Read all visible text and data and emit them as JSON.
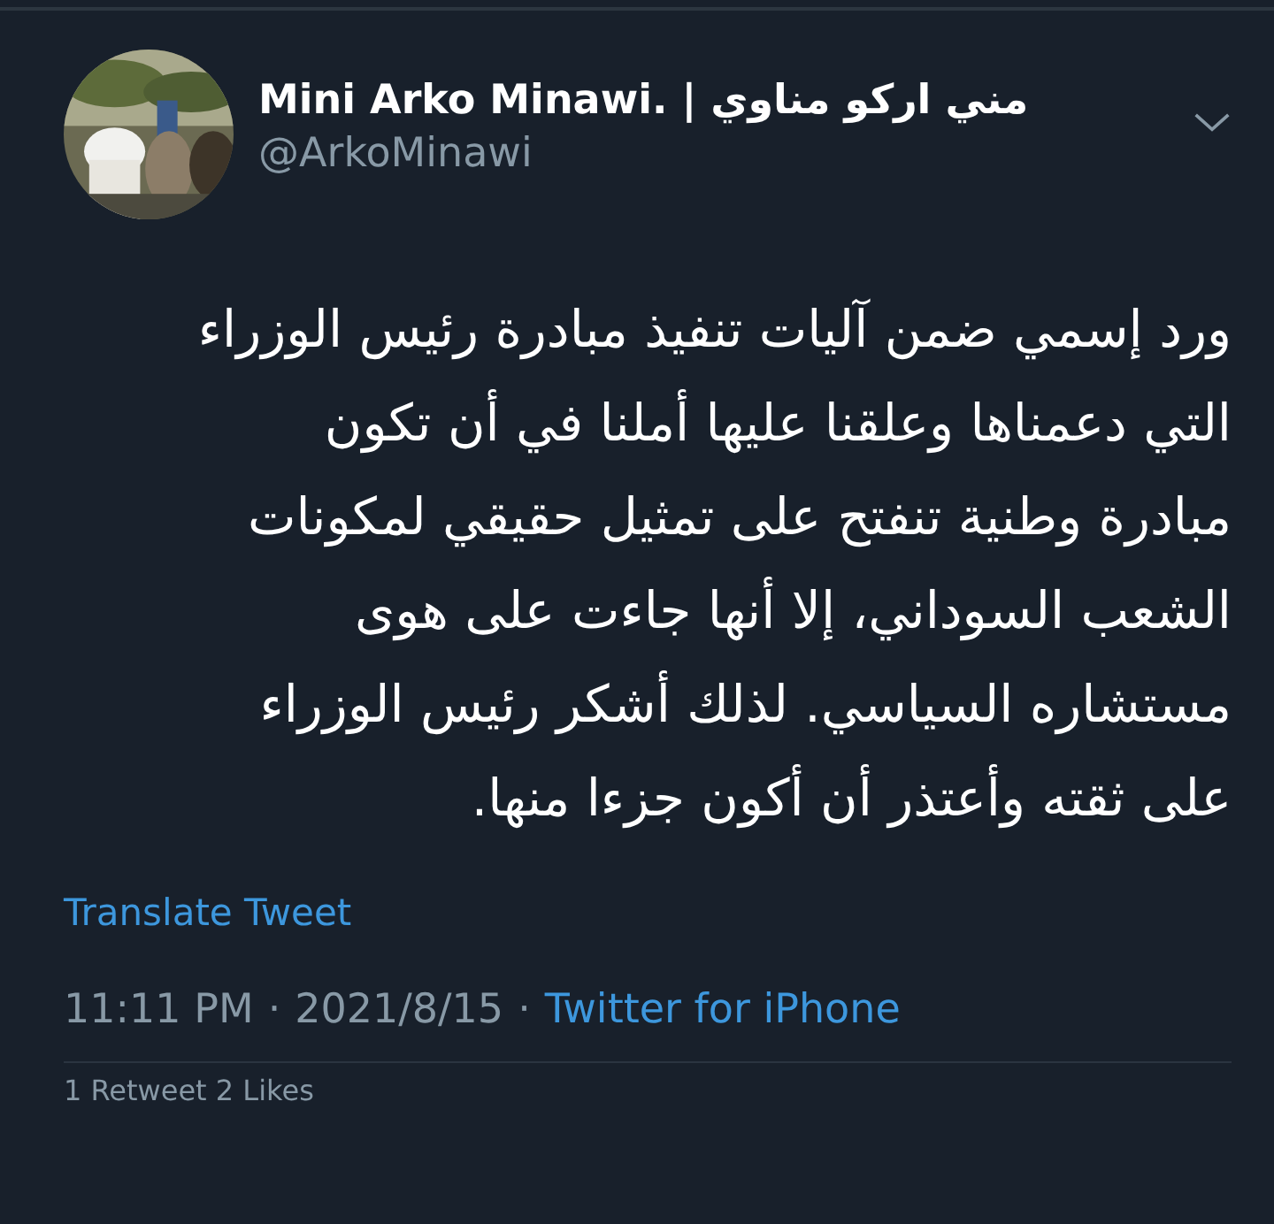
{
  "author": {
    "name": "Mini Arko Minawi. | مني اركو مناوي",
    "handle": "@ArkoMinawi"
  },
  "tweet_text": "ورد إسمي ضمن آليات تنفيذ مبادرة رئيس الوزراء\nالتي دعمناها وعلقنا عليها أملنا في أن تكون\nمبادرة وطنية تنفتح على تمثيل حقيقي لمكونات\nالشعب السوداني، إلا أنها جاءت على هوى\nمستشاره السياسي. لذلك أشكر رئيس الوزراء\nعلى ثقته وأعتذر أن أكون جزءا منها.",
  "translate_link": "Translate Tweet",
  "meta": {
    "time": "11:11 PM",
    "separator_1": "·",
    "date": "2021/8/15",
    "separator_2": "·",
    "source": "Twitter for iPhone"
  },
  "stats": {
    "text": "1 Retweet  2 Likes"
  }
}
